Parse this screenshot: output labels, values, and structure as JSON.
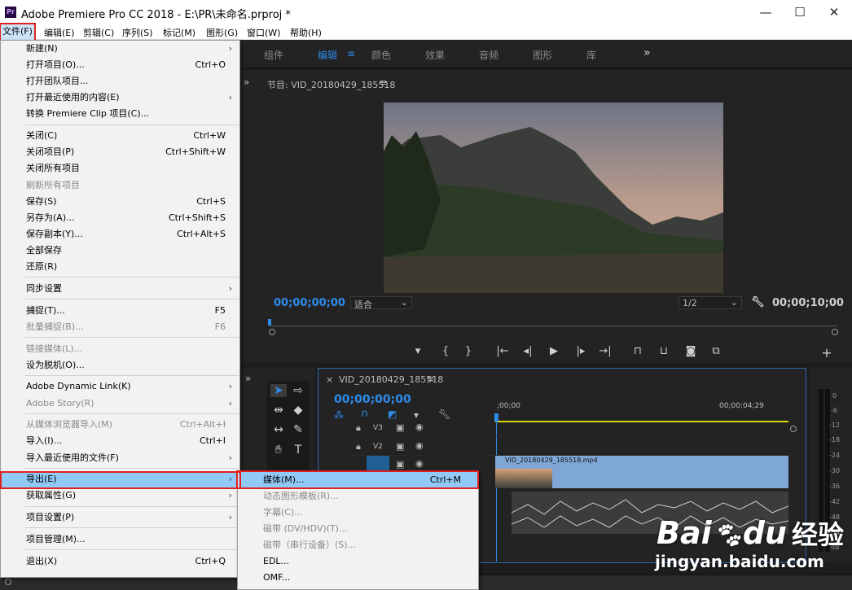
{
  "window": {
    "title": "Adobe Premiere Pro CC 2018 - E:\\PR\\未命名.prproj *",
    "logo": "Pr",
    "min": "—",
    "max": "☐",
    "close": "✕"
  },
  "menubar": [
    "文件(F)",
    "编辑(E)",
    "剪辑(C)",
    "序列(S)",
    "标记(M)",
    "图形(G)",
    "窗口(W)",
    "帮助(H)"
  ],
  "workspace": {
    "tabs": [
      "组件",
      "编辑",
      "颜色",
      "效果",
      "音频",
      "图形",
      "库"
    ],
    "active_tab": "编辑",
    "menu_glyph": "≡",
    "more": "»"
  },
  "program": {
    "title": "节目: VID_20180429_185518",
    "menu_glyph": "≡",
    "timecode_current": "00;00;00;00",
    "fit": "适合",
    "resolution": "1/2",
    "timecode_duration": "00;00;10;00"
  },
  "timeline": {
    "tab": "VID_20180429_185518",
    "close": "×",
    "menu_glyph": "≡",
    "timecode": "00;00;00;00",
    "ruler_start": ";00;00",
    "ruler_mark": "00;00;04;29",
    "tracks": [
      "V3",
      "V2",
      "V1"
    ],
    "clip_name": "VID_20180429_185518.mp4"
  },
  "file_menu": {
    "items": [
      {
        "label": "新建(N)",
        "arrow": true
      },
      {
        "label": "打开项目(O)...",
        "shortcut": "Ctrl+O"
      },
      {
        "label": "打开团队项目..."
      },
      {
        "label": "打开最近使用的内容(E)",
        "arrow": true
      },
      {
        "label": "转换 Premiere Clip 项目(C)..."
      },
      {
        "label": "关闭(C)",
        "shortcut": "Ctrl+W",
        "sep_before": true
      },
      {
        "label": "关闭项目(P)",
        "shortcut": "Ctrl+Shift+W"
      },
      {
        "label": "关闭所有项目"
      },
      {
        "label": "刷新所有项目",
        "disabled": true
      },
      {
        "label": "保存(S)",
        "shortcut": "Ctrl+S"
      },
      {
        "label": "另存为(A)...",
        "shortcut": "Ctrl+Shift+S"
      },
      {
        "label": "保存副本(Y)...",
        "shortcut": "Ctrl+Alt+S"
      },
      {
        "label": "全部保存"
      },
      {
        "label": "还原(R)"
      },
      {
        "label": "同步设置",
        "arrow": true,
        "sep_before": true
      },
      {
        "label": "捕捉(T)...",
        "shortcut": "F5",
        "sep_before": true
      },
      {
        "label": "批量捕捉(B)...",
        "shortcut": "F6",
        "disabled": true
      },
      {
        "label": "链接媒体(L)...",
        "disabled": true,
        "sep_before": true
      },
      {
        "label": "设为脱机(O)..."
      },
      {
        "label": "Adobe Dynamic Link(K)",
        "arrow": true,
        "sep_before": true
      },
      {
        "label": "Adobe Story(R)",
        "arrow": true,
        "disabled": true
      },
      {
        "label": "从媒体浏览器导入(M)",
        "shortcut": "Ctrl+Alt+I",
        "disabled": true,
        "sep_before": true
      },
      {
        "label": "导入(I)...",
        "shortcut": "Ctrl+I"
      },
      {
        "label": "导入最近使用的文件(F)",
        "arrow": true
      },
      {
        "label": "导出(E)",
        "arrow": true,
        "highlighted": true,
        "sep_before": true
      },
      {
        "label": "获取属性(G)",
        "arrow": true
      },
      {
        "label": "项目设置(P)",
        "arrow": true,
        "sep_before": true
      },
      {
        "label": "项目管理(M)...",
        "sep_before": true
      },
      {
        "label": "退出(X)",
        "shortcut": "Ctrl+Q",
        "sep_before": true
      }
    ]
  },
  "export_menu": {
    "items": [
      {
        "label": "媒体(M)...",
        "shortcut": "Ctrl+M",
        "highlighted": true
      },
      {
        "label": "动态图形模板(R)...",
        "disabled": true
      },
      {
        "label": "字幕(C)...",
        "disabled": true
      },
      {
        "label": "磁带 (DV/HDV)(T)...",
        "disabled": true
      },
      {
        "label": "磁带（串行设备）(S)...",
        "disabled": true
      },
      {
        "label": "EDL..."
      },
      {
        "label": "OMF..."
      }
    ]
  },
  "meter_labels": [
    "0",
    "-6",
    "-12",
    "-18",
    "-24",
    "-30",
    "-36",
    "-42",
    "-48",
    "-54",
    "dB"
  ],
  "watermark": {
    "brand": "Bai",
    "brand2": "du",
    "brand3": "经验",
    "url": "jingyan.baidu.com"
  }
}
